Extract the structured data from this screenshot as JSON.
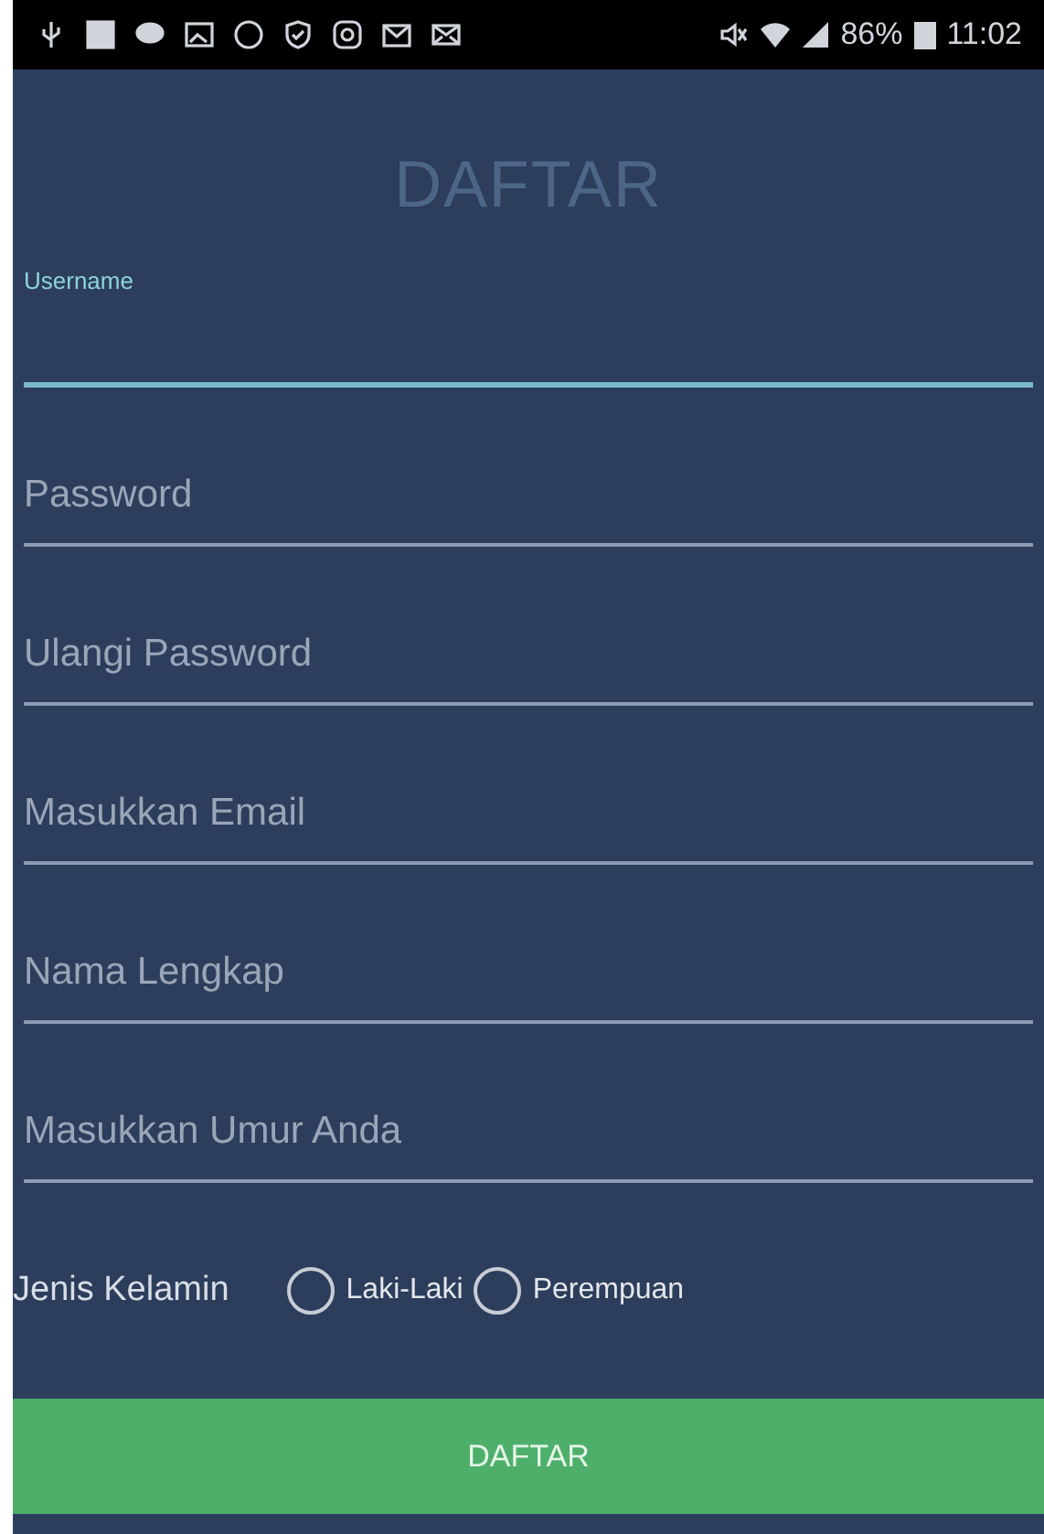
{
  "status_bar": {
    "battery": "86%",
    "time": "11:02"
  },
  "title": "DAFTAR",
  "fields": [
    {
      "label": "Username",
      "focused": true
    },
    {
      "placeholder": "Password",
      "focused": false
    },
    {
      "placeholder": "Ulangi Password",
      "focused": false
    },
    {
      "placeholder": "Masukkan Email",
      "focused": false
    },
    {
      "placeholder": "Nama Lengkap",
      "focused": false
    },
    {
      "placeholder": "Masukkan Umur Anda",
      "focused": false
    }
  ],
  "gender": {
    "label": "Jenis Kelamin",
    "options": [
      {
        "label": "Laki-Laki",
        "selected": false
      },
      {
        "label": "Perempuan",
        "selected": false
      }
    ]
  },
  "submit": "DAFTAR"
}
